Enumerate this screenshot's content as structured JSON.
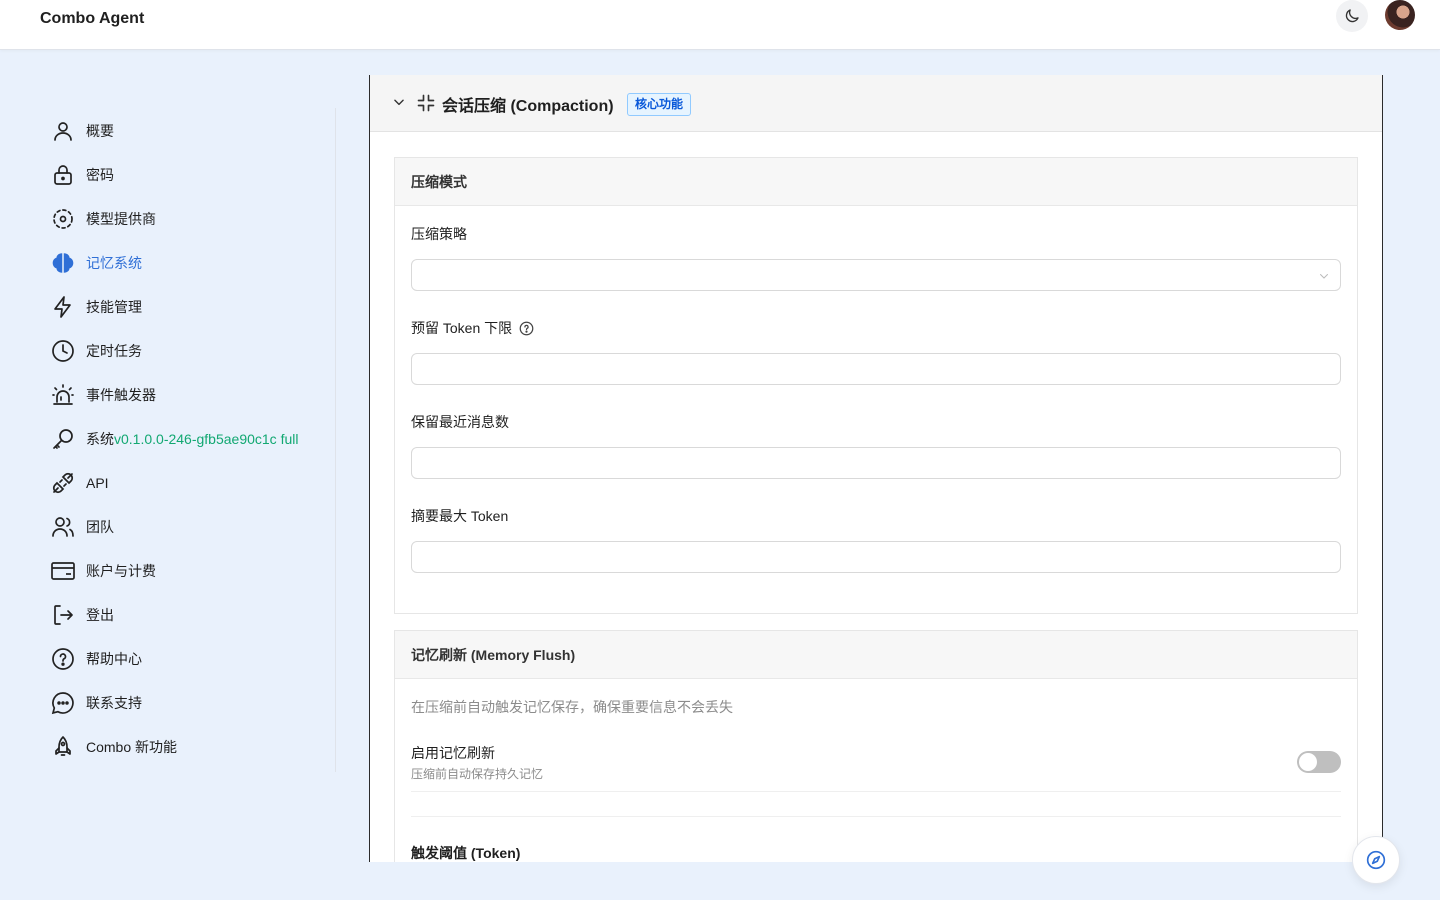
{
  "header": {
    "brand": "Combo Agent",
    "theme_icon": "moon-icon",
    "avatar_icon": "user-avatar"
  },
  "sidebar": {
    "items": [
      {
        "label": "概要",
        "icon": "user-icon",
        "active": false
      },
      {
        "label": "密码",
        "icon": "lock-icon",
        "active": false
      },
      {
        "label": "模型提供商",
        "icon": "model-provider-icon",
        "active": false
      },
      {
        "label": "记忆系统",
        "icon": "brain-icon",
        "active": true
      },
      {
        "label": "技能管理",
        "icon": "lightning-icon",
        "active": false
      },
      {
        "label": "定时任务",
        "icon": "clock-icon",
        "active": false
      },
      {
        "label": "事件触发器",
        "icon": "siren-icon",
        "active": false
      },
      {
        "label": "系统",
        "icon": "key-icon",
        "active": false,
        "version": "v0.1.0.0-246-gfb5ae90c1c full"
      },
      {
        "label": "API",
        "icon": "plug-icon",
        "active": false
      },
      {
        "label": "团队",
        "icon": "team-icon",
        "active": false
      },
      {
        "label": "账户与计费",
        "icon": "credit-card-icon",
        "active": false
      },
      {
        "label": "登出",
        "icon": "logout-icon",
        "active": false
      },
      {
        "label": "帮助中心",
        "icon": "help-icon",
        "active": false
      },
      {
        "label": "联系支持",
        "icon": "chat-icon",
        "active": false
      },
      {
        "label": "Combo 新功能",
        "icon": "rocket-icon",
        "active": false
      }
    ]
  },
  "panel": {
    "title": "会话压缩 (Compaction)",
    "badge": "核心功能",
    "compression_mode": {
      "heading": "压缩模式",
      "strategy_label": "压缩策略",
      "strategy_value": "",
      "reserve_token_label": "预留 Token 下限",
      "reserve_token_value": "",
      "keep_recent_label": "保留最近消息数",
      "keep_recent_value": "",
      "summary_max_label": "摘要最大 Token",
      "summary_max_value": ""
    },
    "memory_flush": {
      "heading": "记忆刷新 (Memory Flush)",
      "description": "在压缩前自动触发记忆保存，确保重要信息不会丢失",
      "enable_label": "启用记忆刷新",
      "enable_sub": "压缩前自动保存持久记忆",
      "enabled": false,
      "threshold_label": "触发阈值 (Token)"
    }
  },
  "colors": {
    "accent": "#2f6fd6",
    "version_green": "#12a872",
    "background": "#e9f1fc"
  }
}
